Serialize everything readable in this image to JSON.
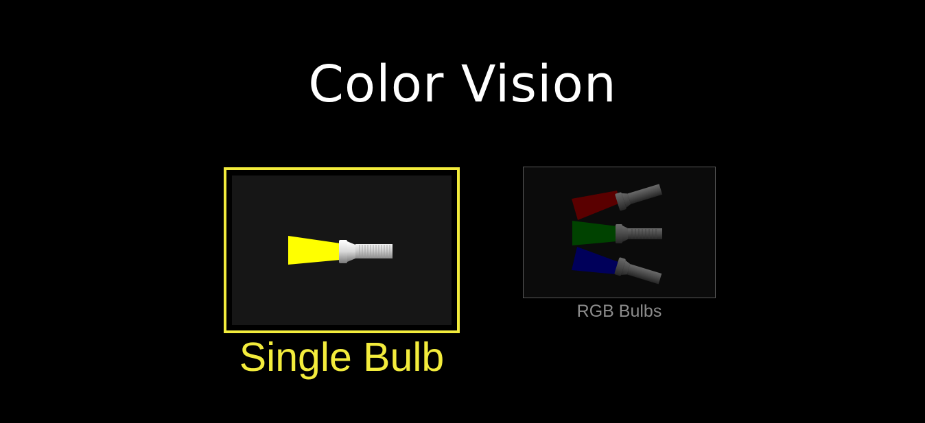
{
  "header": {
    "title": "Color Vision"
  },
  "screens": [
    {
      "label": "Single Bulb",
      "selected": true,
      "icon": "flashlight-icon",
      "beam_color": "#ffff00",
      "accent_color": "#f3ec3c"
    },
    {
      "label": "RGB Bulbs",
      "selected": false,
      "icons": [
        "red-flashlight-icon",
        "green-flashlight-icon",
        "blue-flashlight-icon"
      ],
      "beam_colors": [
        "#5a0000",
        "#004200",
        "#00005a"
      ]
    }
  ],
  "colors": {
    "background": "#000000",
    "title": "#ffffff",
    "selected_accent": "#f3ec3c",
    "unselected_label": "#8c8c8c"
  }
}
